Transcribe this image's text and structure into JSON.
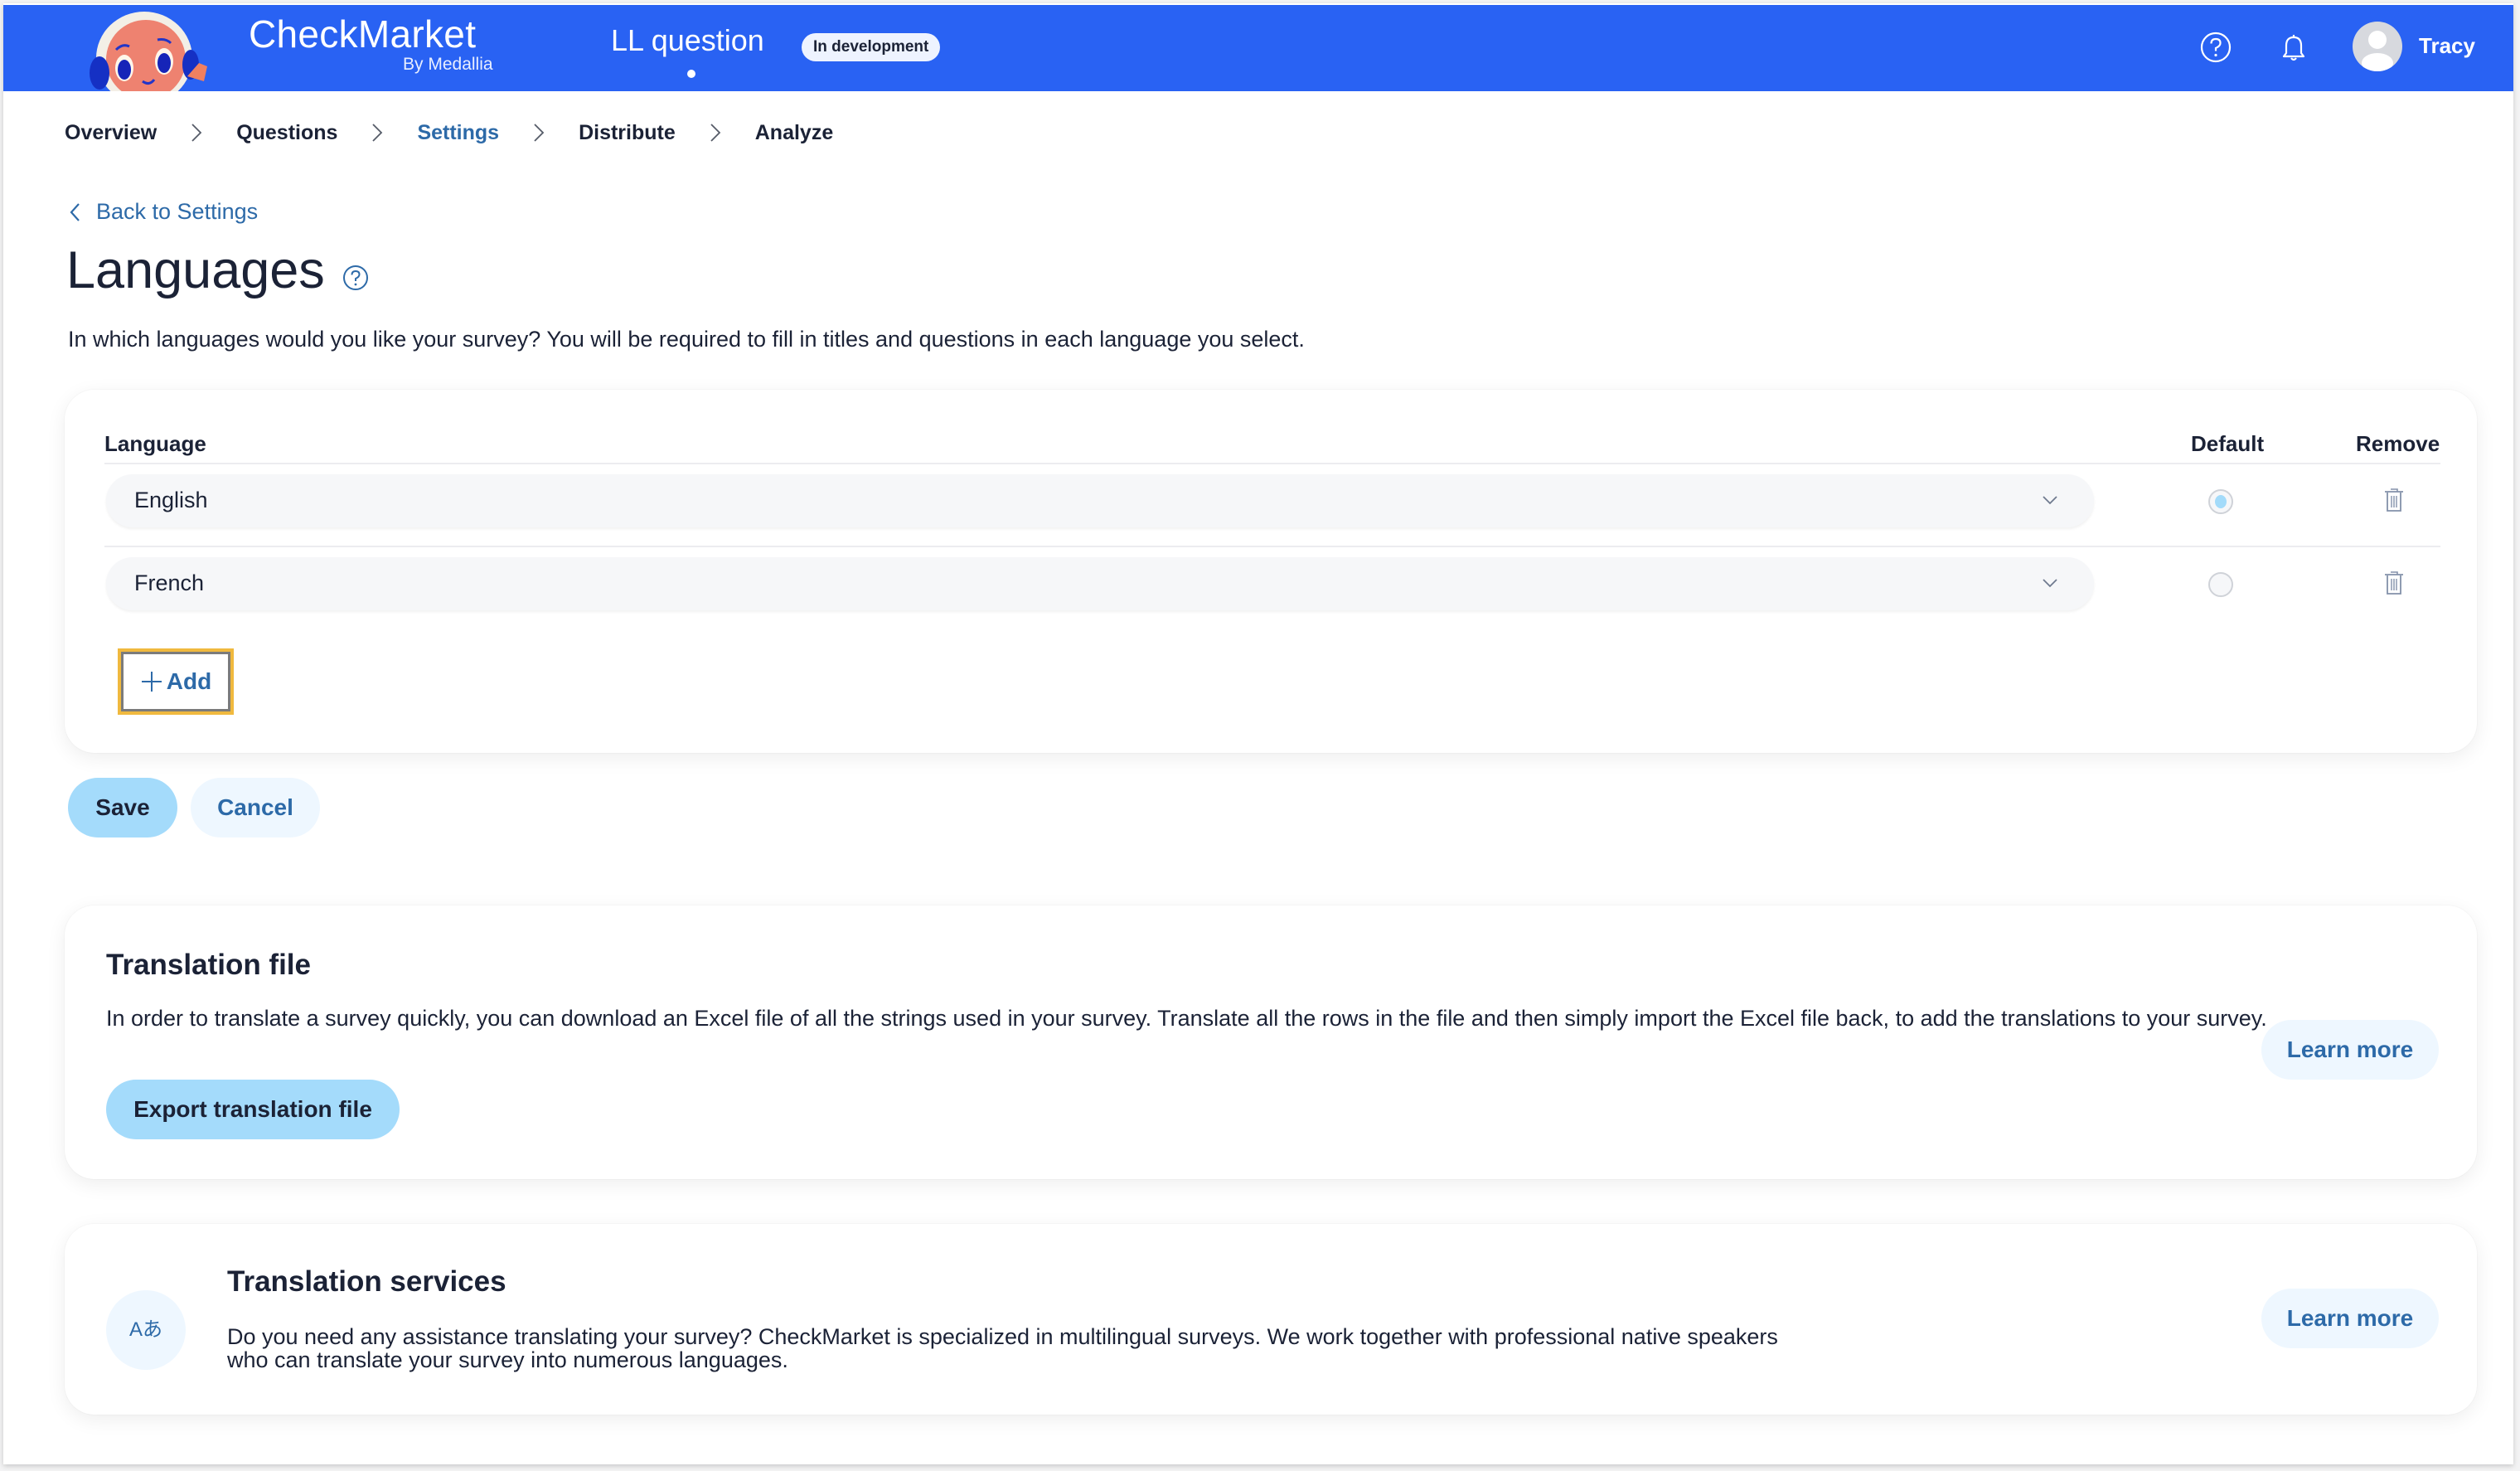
{
  "header": {
    "brand": "CheckMarket",
    "brand_sub": "By Medallia",
    "survey_title": "LL question",
    "status_badge": "In development",
    "user_name": "Tracy",
    "accent_color": "#2962f3"
  },
  "breadcrumb": {
    "items": [
      {
        "label": "Overview",
        "active": false
      },
      {
        "label": "Questions",
        "active": false
      },
      {
        "label": "Settings",
        "active": true
      },
      {
        "label": "Distribute",
        "active": false
      },
      {
        "label": "Analyze",
        "active": false
      }
    ]
  },
  "back_link": "Back to Settings",
  "page": {
    "title": "Languages",
    "description": "In which languages would you like your survey? You will be required to fill in titles and questions in each language you select."
  },
  "languages_table": {
    "columns": {
      "language": "Language",
      "default": "Default",
      "remove": "Remove"
    },
    "rows": [
      {
        "language": "English",
        "default": true
      },
      {
        "language": "French",
        "default": false
      }
    ],
    "add_label": "Add"
  },
  "actions": {
    "save_label": "Save",
    "cancel_label": "Cancel"
  },
  "translation_file": {
    "title": "Translation file",
    "text": "In order to translate a survey quickly, you can download an Excel file of all the strings used in your survey. Translate all the rows in the file and then simply import the Excel file back, to add the translations to your survey.",
    "export_label": "Export translation file",
    "learn_more_label": "Learn more"
  },
  "translation_services": {
    "icon_text": "Aあ",
    "title": "Translation services",
    "text": "Do you need any assistance translating your survey? CheckMarket is specialized in multilingual surveys. We work together with professional native speakers who can translate your survey into numerous languages.",
    "learn_more_label": "Learn more"
  }
}
